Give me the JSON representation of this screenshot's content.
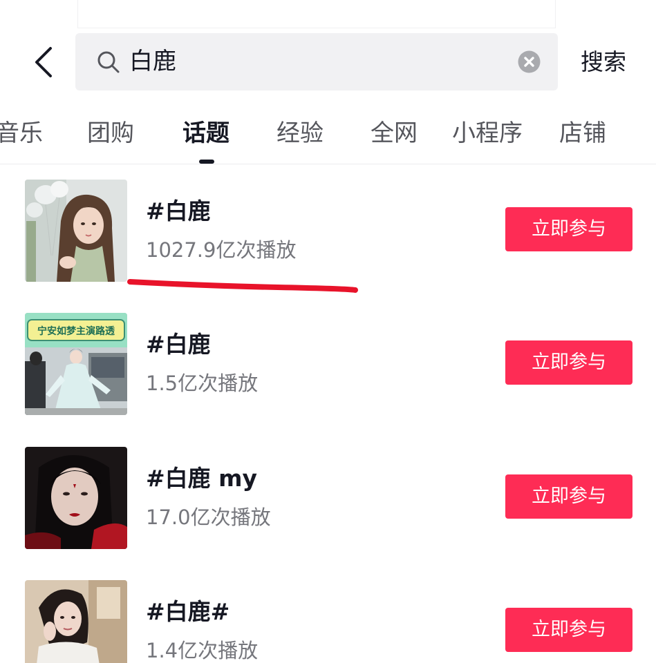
{
  "header": {
    "back_icon": "chevron-left-icon",
    "search_icon": "search-icon",
    "search_value": "白鹿",
    "clear_icon": "clear-icon",
    "search_button_label": "搜索"
  },
  "tabs": [
    {
      "label": "音乐",
      "active": false
    },
    {
      "label": "团购",
      "active": false
    },
    {
      "label": "话题",
      "active": true
    },
    {
      "label": "经验",
      "active": false
    },
    {
      "label": "全网",
      "active": false
    },
    {
      "label": "小程序",
      "active": false
    },
    {
      "label": "店铺",
      "active": false
    }
  ],
  "results": [
    {
      "title": "#白鹿",
      "views": "1027.9亿次播放",
      "button": "立即参与"
    },
    {
      "title": "#白鹿",
      "views": "1.5亿次播放",
      "button": "立即参与",
      "thumb_banner": "宁安如梦主演路透"
    },
    {
      "title": "#白鹿 my",
      "views": "17.0亿次播放",
      "button": "立即参与"
    },
    {
      "title": "#白鹿#",
      "views": "1.4亿次播放",
      "button": "立即参与"
    }
  ],
  "colors": {
    "accent": "#fe2c55",
    "annotation_underline": "#e8132a",
    "text_primary": "#161823",
    "text_secondary": "#75767c",
    "search_bg": "#f1f1f3"
  }
}
